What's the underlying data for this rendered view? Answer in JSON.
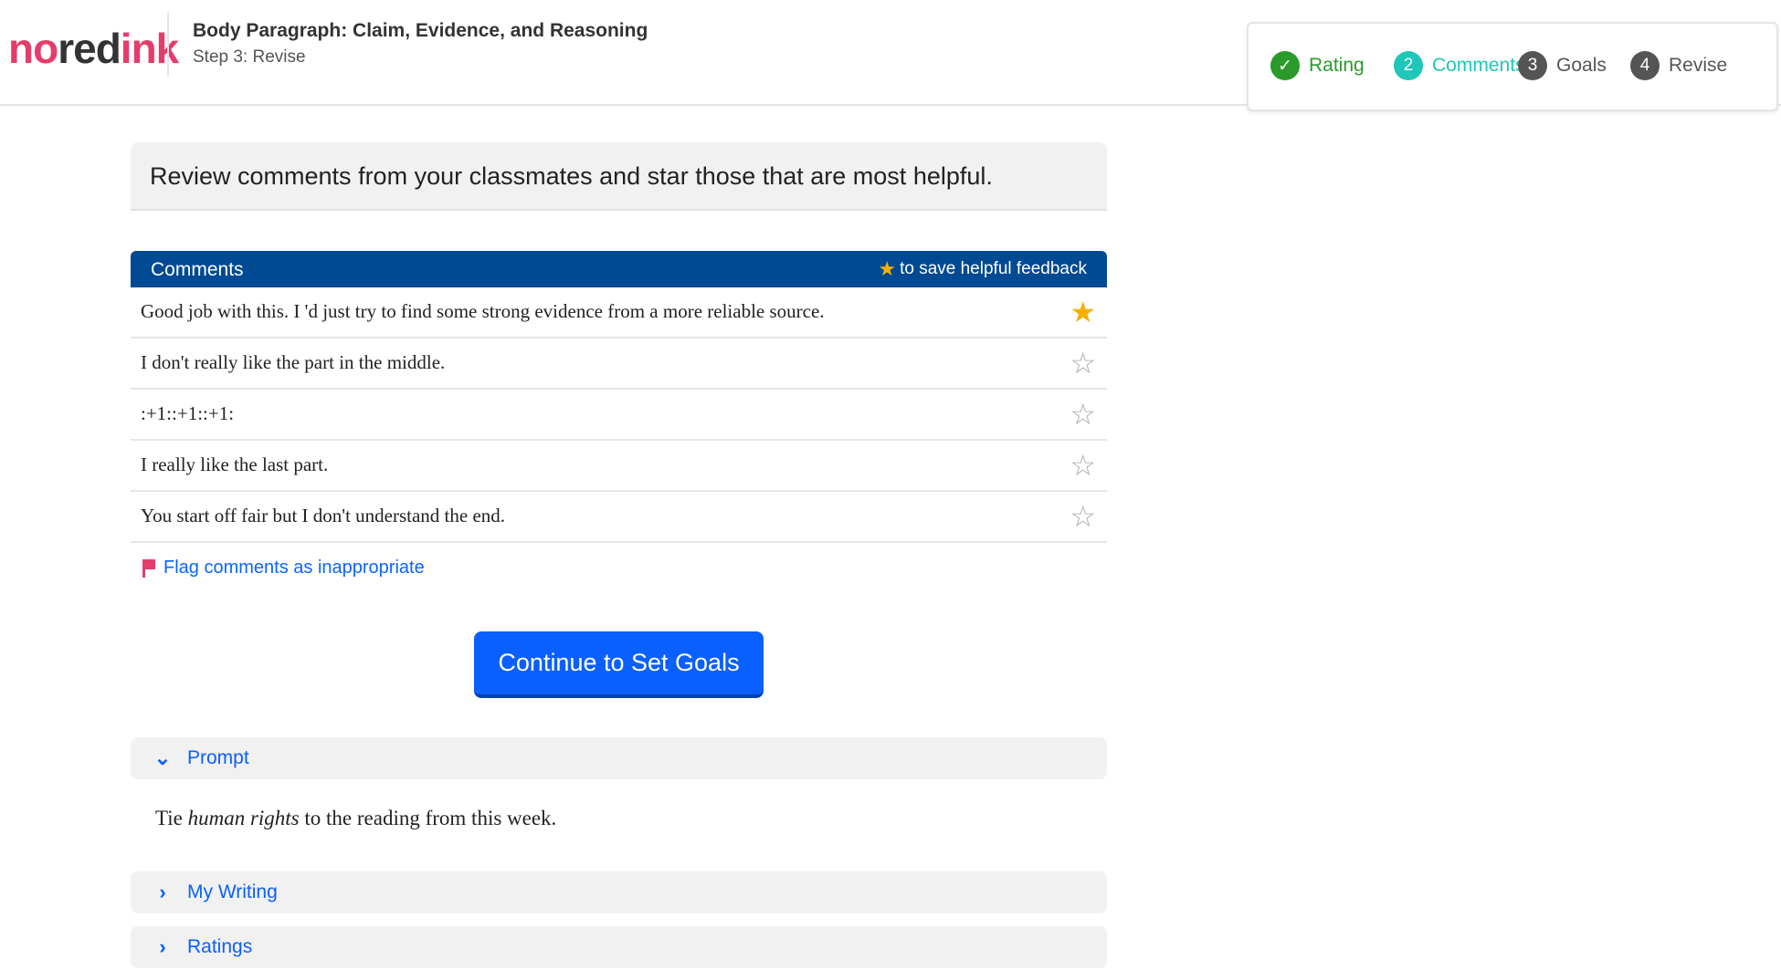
{
  "brand": {
    "part1": "no",
    "part2": "red",
    "part3": "ink"
  },
  "header": {
    "title": "Body Paragraph: Claim, Evidence, and Reasoning",
    "subtitle": "Step 3: Revise"
  },
  "steps": [
    {
      "number": "✓",
      "label": "Rating",
      "state": "done"
    },
    {
      "number": "2",
      "label": "Comments",
      "state": "active"
    },
    {
      "number": "3",
      "label": "Goals",
      "state": "todo"
    },
    {
      "number": "4",
      "label": "Revise",
      "state": "todo"
    }
  ],
  "instruction": "Review comments from your classmates and star those that are most helpful.",
  "comments": {
    "header": "Comments",
    "hint": "to save helpful feedback",
    "items": [
      {
        "text": "Good job with this. I 'd just try to find some strong evidence from a more reliable source.",
        "starred": true
      },
      {
        "text": "I don't really like the part in the middle.",
        "starred": false
      },
      {
        "text": ":+1::+1::+1:",
        "starred": false
      },
      {
        "text": "I really like the last part.",
        "starred": false
      },
      {
        "text": "You start off fair but I don't understand the end.",
        "starred": false
      }
    ]
  },
  "flag_link": "Flag comments as inappropriate",
  "continue_button": "Continue to Set Goals",
  "accordions": {
    "prompt": {
      "label": "Prompt",
      "expanded": true,
      "body_pre": "Tie ",
      "body_em": "human rights",
      "body_post": " to the reading from this week."
    },
    "my_writing": {
      "label": "My Writing",
      "expanded": false
    },
    "ratings": {
      "label": "Ratings",
      "expanded": false
    }
  },
  "colors": {
    "brand_pink": "#e53d6b",
    "navy": "#004a93",
    "primary": "#0a5fff",
    "success": "#2a9a2a",
    "active_teal": "#1ec7b7",
    "star_gold": "#f5b000"
  },
  "icons": {
    "step_done": "check-icon",
    "star_filled": "star-filled-icon",
    "star_empty": "star-outline-icon",
    "flag": "flag-icon",
    "chevron_down": "chevron-down-icon",
    "chevron_right": "chevron-right-icon"
  }
}
